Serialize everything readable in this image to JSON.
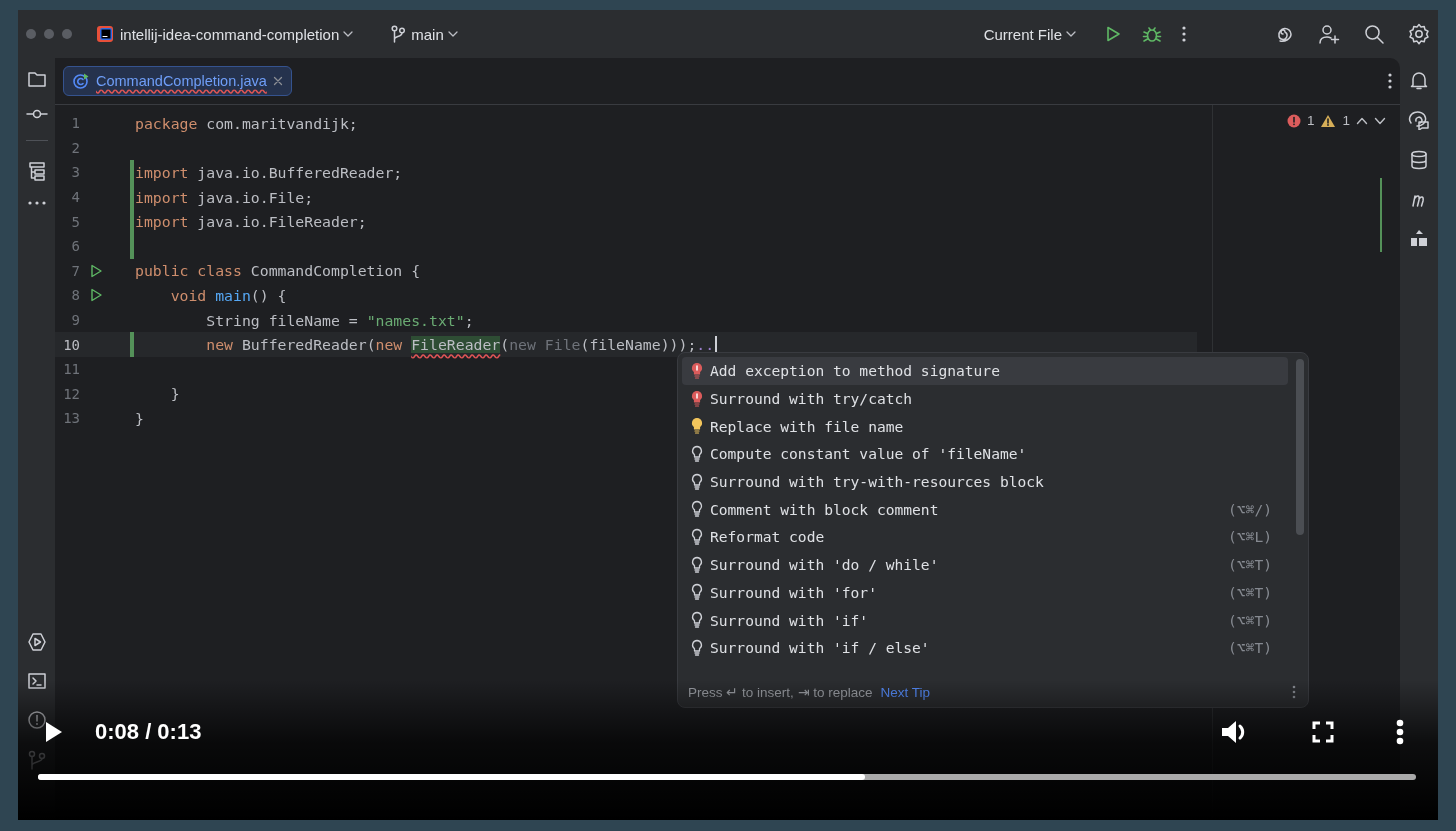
{
  "titlebar": {
    "project": "intellij-idea-command-completion",
    "branch": "main",
    "run_config": "Current File"
  },
  "tabs": [
    {
      "label": "CommandCompletion.java",
      "selected": true
    }
  ],
  "inspections": {
    "errors": "1",
    "warnings": "1"
  },
  "code_lines": [
    {
      "number": "1",
      "changed": false,
      "runnable": false,
      "current": false,
      "tokens": [
        {
          "kind": "keyword",
          "text": "package"
        },
        {
          "kind": "plain",
          "text": " com.maritvandijk;"
        }
      ]
    },
    {
      "number": "2",
      "changed": false,
      "runnable": false,
      "current": false
    },
    {
      "number": "3",
      "changed": true,
      "runnable": false,
      "current": false,
      "tokens": [
        {
          "kind": "keyword",
          "text": "import"
        },
        {
          "kind": "plain",
          "text": " java.io.BufferedReader;"
        }
      ]
    },
    {
      "number": "4",
      "changed": true,
      "runnable": false,
      "current": false,
      "tokens": [
        {
          "kind": "keyword",
          "text": "import"
        },
        {
          "kind": "plain",
          "text": " java.io.File;"
        }
      ]
    },
    {
      "number": "5",
      "changed": true,
      "runnable": false,
      "current": false,
      "tokens": [
        {
          "kind": "keyword",
          "text": "import"
        },
        {
          "kind": "plain",
          "text": " java.io.FileReader;"
        }
      ]
    },
    {
      "number": "6",
      "changed": true,
      "runnable": false,
      "current": false
    },
    {
      "number": "7",
      "changed": false,
      "runnable": true,
      "current": false,
      "tokens": [
        {
          "kind": "keyword",
          "text": "public class"
        },
        {
          "kind": "plain",
          "text": " CommandCompletion {"
        }
      ]
    },
    {
      "number": "8",
      "changed": false,
      "runnable": true,
      "current": false,
      "tokens": [
        {
          "kind": "keyword",
          "text": "    void"
        },
        {
          "kind": "method",
          "text": " main"
        },
        {
          "kind": "plain",
          "text": "() {"
        }
      ]
    },
    {
      "number": "9",
      "changed": false,
      "runnable": false,
      "current": false,
      "tokens": [
        {
          "kind": "plain",
          "text": "        String fileName = "
        },
        {
          "kind": "string",
          "text": "\"names.txt\""
        },
        {
          "kind": "plain",
          "text": ";"
        }
      ]
    },
    {
      "number": "10",
      "changed": true,
      "runnable": false,
      "current": true,
      "tokens": [
        {
          "kind": "keyword",
          "text": "        new"
        },
        {
          "kind": "plain",
          "text": " BufferedReader("
        },
        {
          "kind": "keyword",
          "text": "new "
        },
        {
          "kind": "error",
          "text": "FileReader"
        },
        {
          "kind": "plain",
          "text": "("
        },
        {
          "kind": "dim",
          "text": "new File"
        },
        {
          "kind": "plain",
          "text": "(fileName)));"
        },
        {
          "kind": "suffix",
          "text": ".."
        }
      ]
    },
    {
      "number": "11",
      "changed": false,
      "runnable": false,
      "current": false
    },
    {
      "number": "12",
      "changed": false,
      "runnable": false,
      "current": false,
      "tokens": [
        {
          "kind": "plain",
          "text": "    }"
        }
      ]
    },
    {
      "number": "13",
      "changed": false,
      "runnable": false,
      "current": false,
      "tokens": [
        {
          "kind": "plain",
          "text": "}"
        }
      ]
    }
  ],
  "popup": {
    "items": [
      {
        "label": "Add exception to method signature",
        "kind": "error",
        "selected": true
      },
      {
        "label": "Surround with try/catch",
        "kind": "error",
        "selected": false
      },
      {
        "label": "Replace with file name",
        "kind": "warning",
        "selected": false
      },
      {
        "label": "Compute constant value of 'fileName'",
        "kind": "hint",
        "selected": false
      },
      {
        "label": "Surround with try-with-resources block",
        "kind": "hint",
        "selected": false
      },
      {
        "label": "Comment with block comment",
        "kind": "hint",
        "shortcut": "(⌥⌘/)",
        "selected": false
      },
      {
        "label": "Reformat code",
        "kind": "hint",
        "shortcut": "(⌥⌘L)",
        "selected": false
      },
      {
        "label": "Surround with 'do / while'",
        "kind": "hint",
        "shortcut": "(⌥⌘T)",
        "selected": false
      },
      {
        "label": "Surround with 'for'",
        "kind": "hint",
        "shortcut": "(⌥⌘T)",
        "selected": false
      },
      {
        "label": "Surround with 'if'",
        "kind": "hint",
        "shortcut": "(⌥⌘T)",
        "selected": false
      },
      {
        "label": "Surround with 'if / else'",
        "kind": "hint",
        "shortcut": "(⌥⌘T)",
        "selected": false
      }
    ],
    "footer": {
      "hint": "Press ↵ to insert, ⇥ to replace",
      "link": "Next Tip"
    }
  },
  "video": {
    "time": "0:08 / 0:13",
    "level": 0.6
  }
}
